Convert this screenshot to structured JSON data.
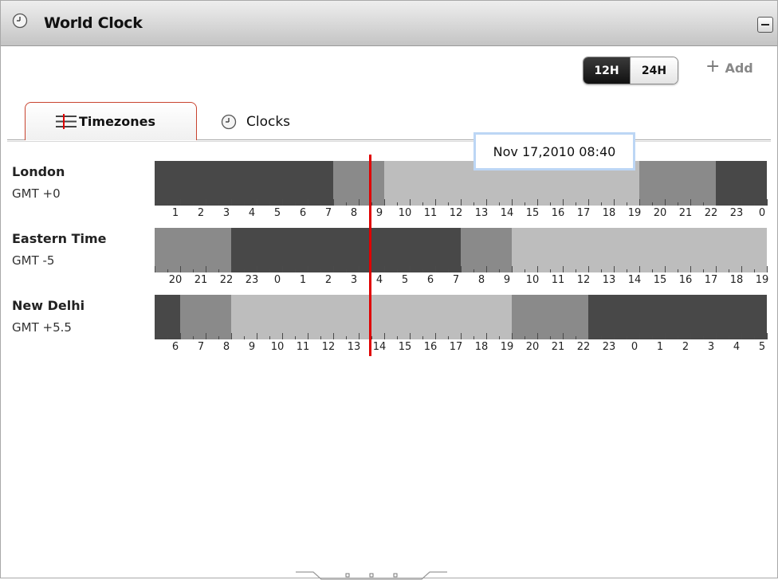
{
  "window": {
    "title": "World Clock"
  },
  "toolbar": {
    "format_12": "12H",
    "format_24": "24H",
    "active_format": "12H",
    "add_label": "Add"
  },
  "tabs": [
    {
      "label": "Timezones",
      "icon": "timezones-icon",
      "active": true
    },
    {
      "label": "Clocks",
      "icon": "clock-icon",
      "active": false
    }
  ],
  "tooltip": {
    "text": "Nov 17,2010 08:40"
  },
  "colors": {
    "night": "#484848",
    "twilight": "#8a8a8a",
    "day": "#bdbdbd",
    "now_line": "#e00000",
    "tab_accent": "#c8432f"
  },
  "timezones": [
    {
      "name": "London",
      "offset": "GMT +0",
      "hours": [
        "1",
        "2",
        "3",
        "4",
        "5",
        "6",
        "7",
        "8",
        "9",
        "10",
        "11",
        "12",
        "13",
        "14",
        "15",
        "16",
        "17",
        "18",
        "19",
        "20",
        "21",
        "22",
        "23",
        "0"
      ],
      "shades": [
        "night",
        "night",
        "night",
        "night",
        "night",
        "night",
        "night",
        "twilight",
        "twilight",
        "day",
        "day",
        "day",
        "day",
        "day",
        "day",
        "day",
        "day",
        "day",
        "day",
        "twilight",
        "twilight",
        "twilight",
        "night",
        "night"
      ]
    },
    {
      "name": "Eastern Time",
      "offset": "GMT -5",
      "hours": [
        "20",
        "21",
        "22",
        "23",
        "0",
        "1",
        "2",
        "3",
        "4",
        "5",
        "6",
        "7",
        "8",
        "9",
        "10",
        "11",
        "12",
        "13",
        "14",
        "15",
        "16",
        "17",
        "18",
        "19"
      ],
      "shades": [
        "twilight",
        "twilight",
        "twilight",
        "night",
        "night",
        "night",
        "night",
        "night",
        "night",
        "night",
        "night",
        "night",
        "twilight",
        "twilight",
        "day",
        "day",
        "day",
        "day",
        "day",
        "day",
        "day",
        "day",
        "day",
        "day"
      ]
    },
    {
      "name": "New Delhi",
      "offset": "GMT +5.5",
      "hours": [
        "6",
        "7",
        "8",
        "9",
        "10",
        "11",
        "12",
        "13",
        "14",
        "15",
        "16",
        "17",
        "18",
        "19",
        "20",
        "21",
        "22",
        "23",
        "0",
        "1",
        "2",
        "3",
        "4",
        "5"
      ],
      "shades": [
        "night",
        "twilight",
        "twilight",
        "day",
        "day",
        "day",
        "day",
        "day",
        "day",
        "day",
        "day",
        "day",
        "day",
        "day",
        "twilight",
        "twilight",
        "twilight",
        "night",
        "night",
        "night",
        "night",
        "night",
        "night",
        "night"
      ]
    }
  ]
}
